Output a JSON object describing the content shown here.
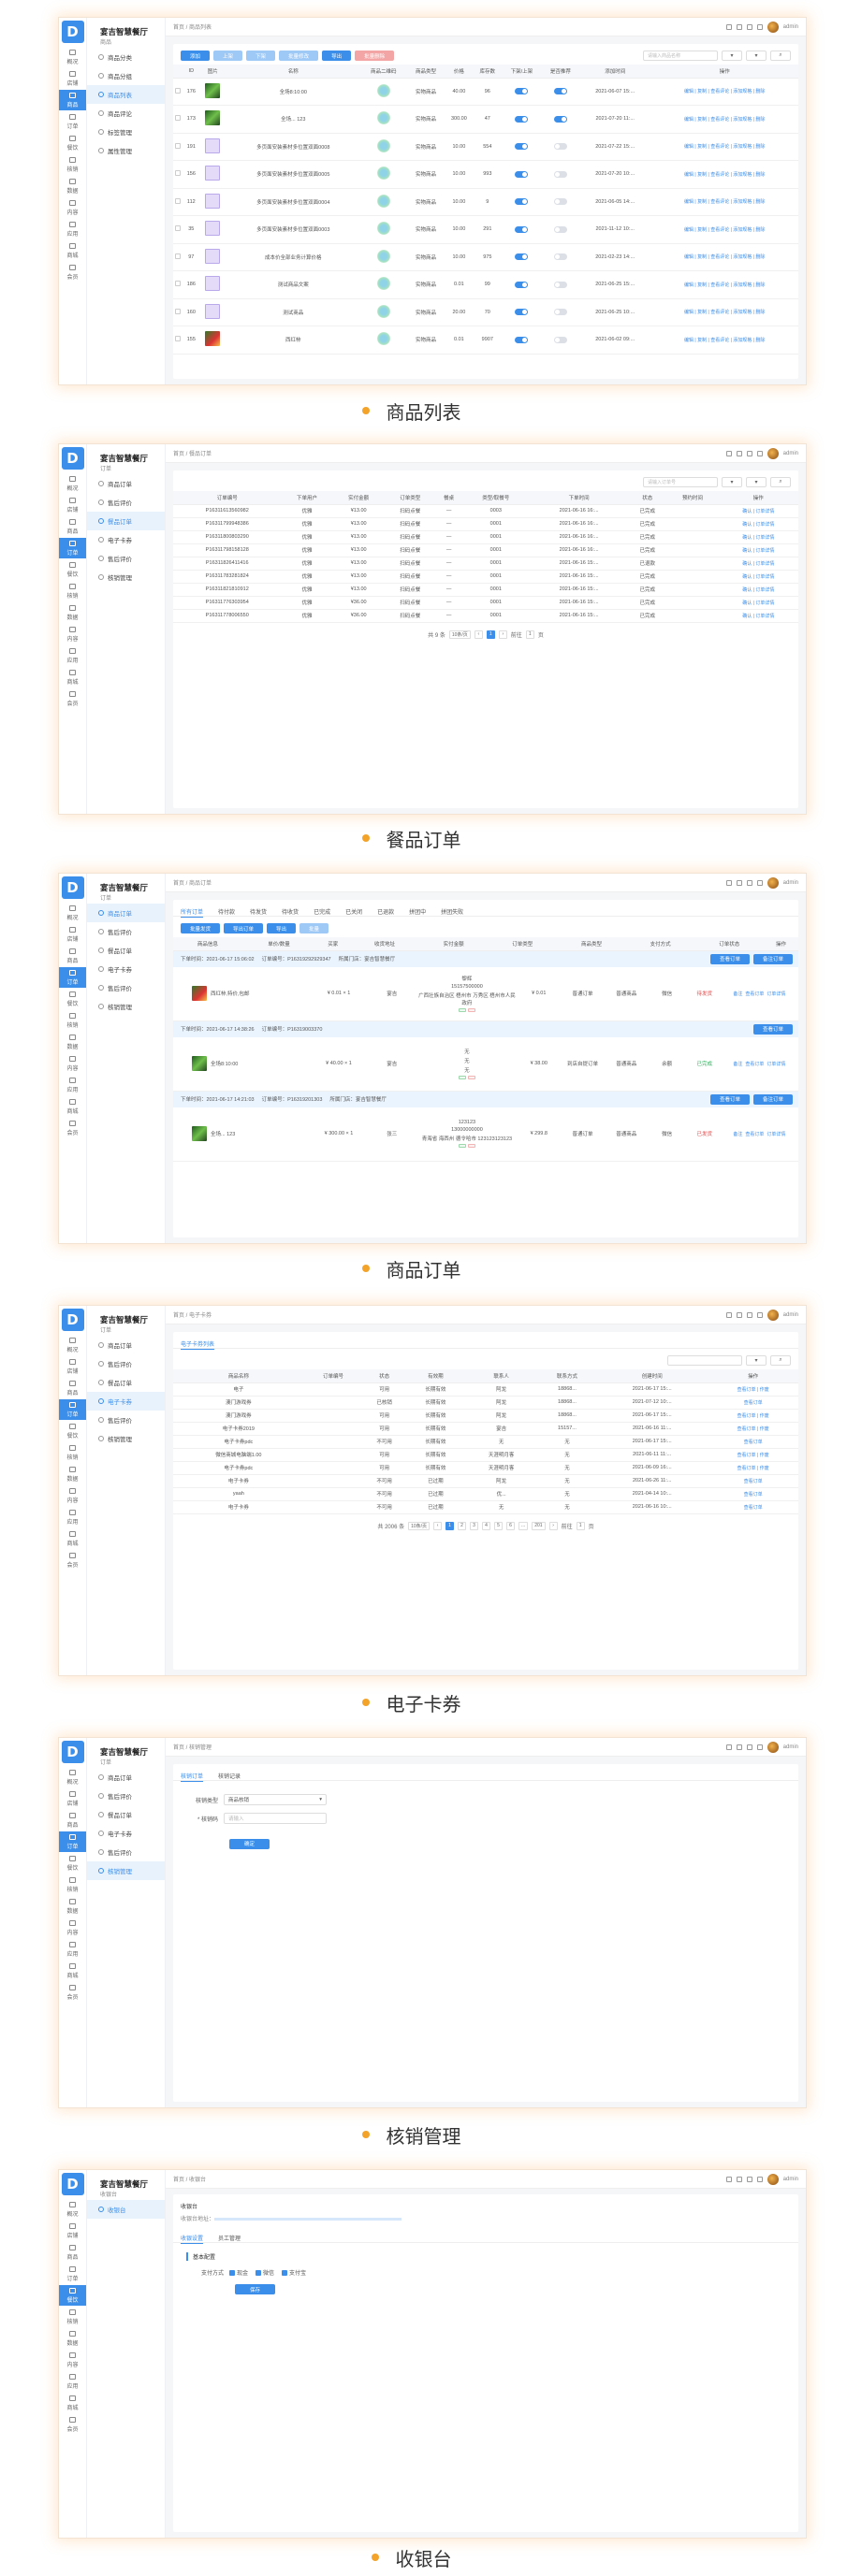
{
  "common": {
    "logo": "D",
    "brand": "宴吉智慧餐厅",
    "user": "admin",
    "nav": [
      "概况",
      "店铺",
      "商品",
      "订单",
      "餐饮",
      "核销",
      "数据",
      "内容",
      "应用",
      "商城",
      "会员"
    ]
  },
  "captions": [
    "商品列表",
    "餐品订单",
    "商品订单",
    "电子卡券",
    "核销管理",
    "收银台"
  ],
  "panel1": {
    "store": "商品",
    "crumb": "首页 / 商品列表",
    "menu": [
      "商品分类",
      "商品分组",
      "商品列表",
      "商品评论",
      "标签管理",
      "属性管理"
    ],
    "buttons": [
      "添加",
      "上架",
      "下架",
      "批量修改",
      "导出",
      "批量删除"
    ],
    "search_placeholder": "请输入商品名称",
    "headers": [
      "",
      "ID",
      "图片",
      "名称",
      "商品二维码",
      "商品类型",
      "价格",
      "库存数",
      "下架/上架",
      "是否推荐",
      "添加时间",
      "操作"
    ],
    "rows": [
      {
        "id": "176",
        "img": "g",
        "name": "全场8:10:00",
        "type": "实物商品",
        "price": "40.00",
        "stock": "96",
        "on": true,
        "rec": true,
        "date": "2021-06-07 15:..."
      },
      {
        "id": "173",
        "img": "g",
        "name": "全场... 123",
        "type": "实物商品",
        "price": "300.00",
        "stock": "47",
        "on": true,
        "rec": true,
        "date": "2021-07-20 11:..."
      },
      {
        "id": "191",
        "img": "p",
        "name": "多页面安装素材多位置双面0008",
        "type": "实物商品",
        "price": "10.00",
        "stock": "554",
        "on": true,
        "rec": false,
        "date": "2021-07-22 15:..."
      },
      {
        "id": "156",
        "img": "p",
        "name": "多页面安装素材多位置双面0005",
        "type": "实物商品",
        "price": "10.00",
        "stock": "993",
        "on": true,
        "rec": false,
        "date": "2021-07-20 10:..."
      },
      {
        "id": "112",
        "img": "p",
        "name": "多页面安装素材多位置双面0004",
        "type": "实物商品",
        "price": "10.00",
        "stock": "9",
        "on": true,
        "rec": false,
        "date": "2021-06-05 14:..."
      },
      {
        "id": "35",
        "img": "p",
        "name": "多页面安装素材多位置双面0003",
        "type": "实物商品",
        "price": "10.00",
        "stock": "291",
        "on": true,
        "rec": false,
        "date": "2021-11-12 10:..."
      },
      {
        "id": "97",
        "img": "p",
        "name": "成本价全部业务计算价格",
        "type": "实物商品",
        "price": "10.00",
        "stock": "975",
        "on": true,
        "rec": false,
        "date": "2021-02-23 14:..."
      },
      {
        "id": "186",
        "img": "p",
        "name": "测试商品文案",
        "type": "实物商品",
        "price": "0.01",
        "stock": "99",
        "on": true,
        "rec": false,
        "date": "2021-06-25 15:..."
      },
      {
        "id": "160",
        "img": "p",
        "name": "测试商品",
        "type": "实物商品",
        "price": "20.00",
        "stock": "70",
        "on": true,
        "rec": false,
        "date": "2021-06-25 10:..."
      },
      {
        "id": "155",
        "img": "r",
        "name": "西红柿",
        "type": "实物商品",
        "price": "0.01",
        "stock": "9907",
        "on": true,
        "rec": false,
        "date": "2021-06-02 09:..."
      }
    ],
    "ops": "编辑 | 复制 | 查看评论 | 添加规格 | 删除"
  },
  "panel2": {
    "store": "订单",
    "crumb": "首页 / 餐品订单",
    "menu": [
      "商品订单",
      "售后评价",
      "餐品订单",
      "电子卡券",
      "售后评价",
      "核销管理"
    ],
    "search_placeholder": "请输入订单号",
    "headers": [
      "订单编号",
      "下单用户",
      "实付金额",
      "订单类型",
      "餐桌",
      "类型/取餐号",
      "下单时间",
      "状态",
      "预约时间",
      "操作"
    ],
    "rows": [
      {
        "no": "P16311613560982",
        "user": "优雅",
        "pay": "¥13.00",
        "type": "扫码点餐",
        "table": "—",
        "num": "0003",
        "time": "2021-06-16 16:...",
        "status": "已完成"
      },
      {
        "no": "P16311799948386",
        "user": "优雅",
        "pay": "¥13.00",
        "type": "扫码点餐",
        "table": "—",
        "num": "0001",
        "time": "2021-06-16 16:...",
        "status": "已完成"
      },
      {
        "no": "P16311800803290",
        "user": "优雅",
        "pay": "¥13.00",
        "type": "扫码点餐",
        "table": "—",
        "num": "0001",
        "time": "2021-06-16 16:...",
        "status": "已完成"
      },
      {
        "no": "P16311798158128",
        "user": "优雅",
        "pay": "¥13.00",
        "type": "扫码点餐",
        "table": "—",
        "num": "0001",
        "time": "2021-06-16 16:...",
        "status": "已完成"
      },
      {
        "no": "P16311826411416",
        "user": "优雅",
        "pay": "¥13.00",
        "type": "扫码点餐",
        "table": "—",
        "num": "0001",
        "time": "2021-06-16 15:...",
        "status": "已退款"
      },
      {
        "no": "P16311783281824",
        "user": "优雅",
        "pay": "¥13.00",
        "type": "扫码点餐",
        "table": "—",
        "num": "0001",
        "time": "2021-06-16 15:...",
        "status": "已完成"
      },
      {
        "no": "P16311821810912",
        "user": "优雅",
        "pay": "¥13.00",
        "type": "扫码点餐",
        "table": "—",
        "num": "0001",
        "time": "2021-06-16 15:...",
        "status": "已完成"
      },
      {
        "no": "P16311776303954",
        "user": "优雅",
        "pay": "¥36.00",
        "type": "扫码点餐",
        "table": "—",
        "num": "0001",
        "time": "2021-06-16 15:...",
        "status": "已完成"
      },
      {
        "no": "P16311778006550",
        "user": "优雅",
        "pay": "¥36.00",
        "type": "扫码点餐",
        "table": "—",
        "num": "0001",
        "time": "2021-06-16 15:...",
        "status": "已完成"
      }
    ],
    "ops": "确认 | 订单详情",
    "pag": {
      "total": "共 9 条",
      "size": "10条/页",
      "page": "1",
      "goto": "前往",
      "page_suffix": "页"
    }
  },
  "panel3": {
    "store": "订单",
    "crumb": "首页 / 商品订单",
    "menu": [
      "商品订单",
      "售后评价",
      "餐品订单",
      "电子卡券",
      "售后评价",
      "核销管理"
    ],
    "tabs": [
      "所有订单",
      "待付款",
      "待发货",
      "待收货",
      "已完成",
      "已关闭",
      "已退款",
      "拼团中",
      "拼团失败"
    ],
    "buttons": [
      "批量发货",
      "导出订单",
      "导出",
      "批量"
    ],
    "headers": [
      "商品信息",
      "单价/数量",
      "买家",
      "收货地址",
      "实付金额",
      "订单类型",
      "商品类型",
      "支付方式",
      "订单状态",
      "操作"
    ],
    "orders": [
      {
        "time": "下单时间：2021-06-17 15:06:02",
        "no": "订单编号：P16319292929347",
        "store": "所属门店：宴吉智慧餐厅",
        "img": "r",
        "goods": "西红柿,特价,包邮",
        "qty": "¥ 0.01 × 1",
        "buyer": "宴吉",
        "addr1": "黎辉",
        "addr2": "15157500000",
        "addr3": "广西壮族自治区 梧州市 万秀区 梧州市人民政府",
        "pay": "¥ 0.01",
        "otype": "普通订单",
        "gtype": "普通商品",
        "method": "微信",
        "status": "待发货",
        "hbtns": [
          "查看订单",
          "备注订单"
        ],
        "ops": [
          "备注",
          "查看订单",
          "订单详情"
        ]
      },
      {
        "time": "下单时间：2021-06-17 14:38:26",
        "no": "订单编号：P16319003370",
        "store": "",
        "img": "g",
        "goods": "全场8:10:00",
        "qty": "¥ 40.00 × 1",
        "buyer": "宴吉",
        "addr1": "无",
        "addr2": "无",
        "addr3": "无",
        "pay": "¥ 38.00",
        "otype": "到店自提订单",
        "gtype": "普通商品",
        "method": "余额",
        "status": "已完成",
        "hbtns": [
          "查看订单"
        ],
        "ops": [
          "备注",
          "查看订单",
          "订单详情"
        ]
      },
      {
        "time": "下单时间：2021-06-17 14:21:03",
        "no": "订单编号：P16319201303",
        "store": "所属门店：宴吉智慧餐厅",
        "img": "g",
        "goods": "全场... 123",
        "qty": "¥ 300.00 × 1",
        "buyer": "张三",
        "addr1": "123123",
        "addr2": "13000000000",
        "addr3": "青海省 海西州 德令哈市 123123123123",
        "pay": "¥ 299.8",
        "otype": "普通订单",
        "gtype": "普通商品",
        "method": "微信",
        "status": "已发货",
        "hbtns": [
          "查看订单",
          "备注订单"
        ],
        "ops": [
          "备注",
          "查看订单",
          "订单详情"
        ]
      }
    ]
  },
  "panel4": {
    "store": "订单",
    "crumb": "首页 / 电子卡券",
    "menu": [
      "商品订单",
      "售后评价",
      "餐品订单",
      "电子卡券",
      "售后评价",
      "核销管理"
    ],
    "tab": "电子卡券列表",
    "headers": [
      "商品名称",
      "订单编号",
      "状态",
      "有效期",
      "联系人",
      "联系方式",
      "创建时间",
      "操作"
    ],
    "rows": [
      {
        "name": "电子",
        "no": "",
        "status": "可用",
        "valid": "长期有效",
        "contact": "阿龙",
        "phone": "18868...",
        "time": "2021-06-17 15:...",
        "ops": "查看订单 | 作废"
      },
      {
        "name": "澳门游戏券",
        "no": "",
        "status": "已核销",
        "valid": "长期有效",
        "contact": "阿龙",
        "phone": "18868...",
        "time": "2021-07-12 10:...",
        "ops": "查看订单"
      },
      {
        "name": "澳门游戏券",
        "no": "",
        "status": "可用",
        "valid": "长期有效",
        "contact": "阿龙",
        "phone": "18868...",
        "time": "2021-06-17 15:...",
        "ops": "查看订单 | 作废"
      },
      {
        "name": "电子卡券2019",
        "no": "",
        "status": "可用",
        "valid": "长期有效",
        "contact": "宴吉",
        "phone": "15157...",
        "time": "2021-06-16 11:...",
        "ops": "查看订单 | 作废"
      },
      {
        "name": "电子卡券pdc",
        "no": "",
        "status": "不可用",
        "valid": "长期有效",
        "contact": "无",
        "phone": "无",
        "time": "2021-06-17 15:...",
        "ops": "查看订单"
      },
      {
        "name": "微信商城电脑端1.00",
        "no": "",
        "status": "可用",
        "valid": "长期有效",
        "contact": "天涯明月客",
        "phone": "无",
        "time": "2021-06-11 11:...",
        "ops": "查看订单 | 作废"
      },
      {
        "name": "电子卡券pdc",
        "no": "",
        "status": "可用",
        "valid": "长期有效",
        "contact": "天涯明月客",
        "phone": "无",
        "time": "2021-06-09 16:...",
        "ops": "查看订单 | 作废"
      },
      {
        "name": "电子卡券",
        "no": "",
        "status": "不可用",
        "valid": "已过期",
        "contact": "阿龙",
        "phone": "无",
        "time": "2021-06-26 11:...",
        "ops": "查看订单"
      },
      {
        "name": "yaah",
        "no": "",
        "status": "不可用",
        "valid": "已过期",
        "contact": "优...",
        "phone": "无",
        "time": "2021-04-14 10:...",
        "ops": "查看订单"
      },
      {
        "name": "电子卡券",
        "no": "",
        "status": "不可用",
        "valid": "已过期",
        "contact": "无",
        "phone": "无",
        "time": "2021-06-16 10:...",
        "ops": "查看订单"
      }
    ],
    "pag": {
      "total": "共 2006 条",
      "size": "10条/页",
      "pages": [
        "1",
        "2",
        "3",
        "4",
        "5",
        "6",
        "...",
        "201"
      ],
      "goto": "前往",
      "page": "1",
      "page_suffix": "页"
    }
  },
  "panel5": {
    "store": "订单",
    "crumb": "首页 / 核销管理",
    "menu": [
      "商品订单",
      "售后评价",
      "餐品订单",
      "电子卡券",
      "售后评价",
      "核销管理"
    ],
    "tabs": [
      "核销订单",
      "核销记录"
    ],
    "label1": "核销类型",
    "value1": "商品核销",
    "label2": "* 核销码",
    "placeholder2": "请输入",
    "submit": "确定"
  },
  "panel6": {
    "store": "收银台",
    "crumb": "首页 / 收银台",
    "menu": [
      "收银台"
    ],
    "title": "收银台",
    "link_label": "收银台地址：",
    "tabs": [
      "收银设置",
      "员工管理"
    ],
    "section": "基本配置",
    "pay_label": "支付方式",
    "pays": [
      "现金",
      "微信",
      "支付宝"
    ],
    "save": "保存"
  },
  "colors": {
    "primary": "#3b8ee9",
    "accent": "#f4a32a"
  }
}
